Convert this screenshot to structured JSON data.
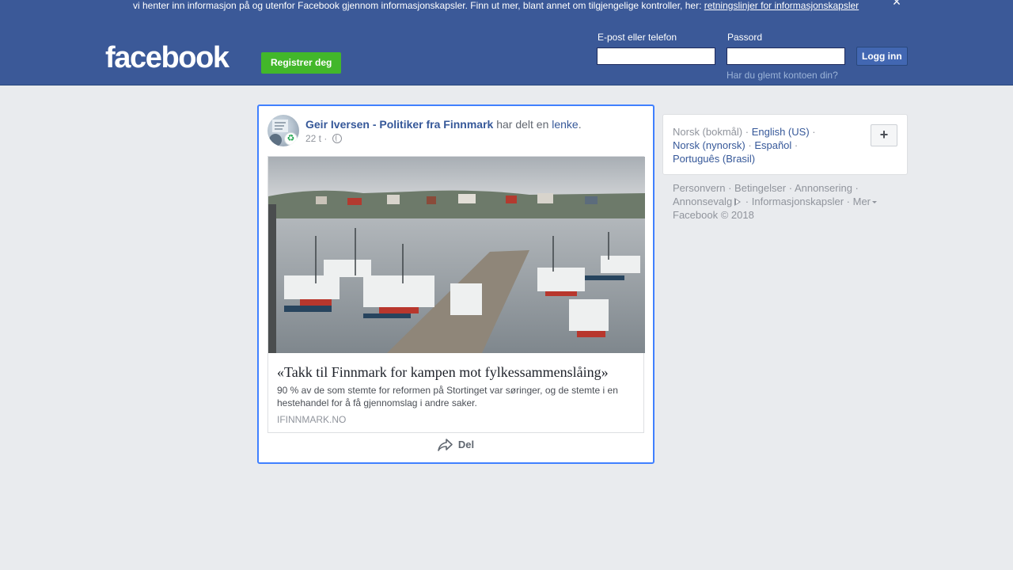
{
  "cookie_banner": {
    "text": "vi henter inn informasjon på og utenfor Facebook gjennom informasjonskapsler. Finn ut mer, blant annet om tilgjengelige kontroller, her: ",
    "link": "retningslinjer for informasjonskapsler",
    "close_icon": "close-icon"
  },
  "header": {
    "logo": "facebook",
    "register_label": "Registrer deg",
    "email_label": "E-post eller telefon",
    "password_label": "Passord",
    "email_value": "",
    "password_value": "",
    "login_label": "Logg inn",
    "forgot_label": "Har du glemt kontoen din?"
  },
  "post": {
    "author": "Geir Iversen - Politiker fra Finnmark",
    "shared_text": " har delt en ",
    "link_word": "lenke",
    "period": ".",
    "time": "22 t",
    "separator": " · ",
    "privacy_icon": "globe-icon",
    "link": {
      "title": "«Takk til Finnmark for kampen mot fylkessammenslåing»",
      "description": "90 % av de som stemte for reformen på Stortinget var søringer, og de stemte i en hestehandel for å få gjennomslag i andre saker.",
      "domain": "IFINNMARK.NO"
    },
    "share_label": "Del",
    "share_icon": "share-icon"
  },
  "languages": {
    "current": "Norsk (bokmål)",
    "options": [
      "English (US)",
      "Norsk (nynorsk)",
      "Español",
      "Português (Brasil)"
    ],
    "add_label": "+"
  },
  "footer": {
    "links": [
      "Personvern",
      "Betingelser",
      "Annonsering",
      "Annonsevalg",
      "Informasjonskapsler",
      "Mer"
    ],
    "copyright": "Facebook © 2018"
  },
  "colors": {
    "brand": "#3b5998",
    "link": "#365899",
    "register": "#42b72a",
    "focus_border": "#4080ff"
  }
}
